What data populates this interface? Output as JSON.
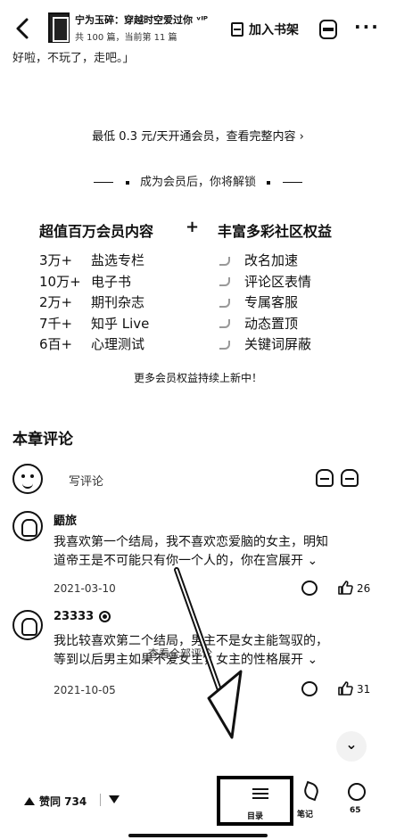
{
  "header": {
    "book_title": "宁为玉碎：穿越时空爱过你 ᵛᴵᴾ",
    "book_meta": "共 100 篇，当前第 11 篇",
    "add_shelf_label": "加入书架",
    "more_glyph": "···"
  },
  "reader": {
    "cut_text": "好啦，不玩了，走吧。」"
  },
  "paywall": {
    "cta": "最低 0.3 元/天开通会员，查看完整内容 ›",
    "unlock_text": "成为会员后，你将解锁",
    "left_head": "超值百万会员内容",
    "plus": "+",
    "right_head": "丰富多彩社区权益",
    "left_items": [
      {
        "num": "3万+",
        "name": "盐选专栏"
      },
      {
        "num": "10万+",
        "name": "电子书"
      },
      {
        "num": "2万+",
        "name": "期刊杂志"
      },
      {
        "num": "7千+",
        "name": "知乎 Live"
      },
      {
        "num": "6百+",
        "name": "心理测试"
      }
    ],
    "right_items": [
      {
        "name": "改名加速"
      },
      {
        "name": "评论区表情"
      },
      {
        "name": "专属客服"
      },
      {
        "name": "动态置顶"
      },
      {
        "name": "关键词屏蔽"
      }
    ],
    "more_benefits": "更多会员权益持续上新中！"
  },
  "comments_section": {
    "title": "本章评论",
    "write_label": "写评论",
    "comments": [
      {
        "user": "鼯旅",
        "line1": "我喜欢第一个结局，我不喜欢恋爱脑的女主，明知",
        "line2": "道帝王是不可能只有你一个人的，你在宫",
        "expand": "展开 ⌄",
        "date": "2021-03-10",
        "likes": "26"
      },
      {
        "user": "23333",
        "line1": "我比较喜欢第二个结局，男主不是女主能驾驭的，",
        "line2": "等到以后男主如果不爱女主，女主的性格",
        "expand": "展开 ⌄",
        "date": "2021-10-05",
        "likes": "31"
      }
    ],
    "view_all": "查看全部评论",
    "scroll_glyph": "⌄"
  },
  "bottom_bar": {
    "vote_label": "赞同 734",
    "toc_label": "目录",
    "note_label": "笔记",
    "comment_count": "65"
  }
}
